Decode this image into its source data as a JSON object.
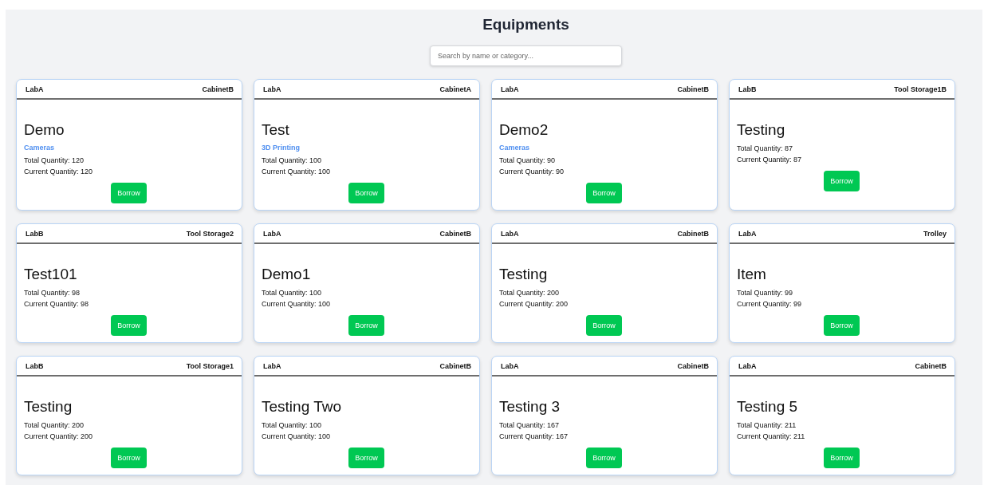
{
  "title": "Equipments",
  "search": {
    "placeholder": "Search by name or category..."
  },
  "cards": [
    {
      "lab": "LabA",
      "storage": "CabinetB",
      "name": "Demo",
      "category": "Cameras",
      "total": "Total Quantity: 120",
      "current": "Current Quantity: 120",
      "button": "Borrow"
    },
    {
      "lab": "LabA",
      "storage": "CabinetA",
      "name": "Test",
      "category": "3D Printing",
      "total": "Total Quantity: 100",
      "current": "Current Quantity: 100",
      "button": "Borrow"
    },
    {
      "lab": "LabA",
      "storage": "CabinetB",
      "name": "Demo2",
      "category": "Cameras",
      "total": "Total Quantity: 90",
      "current": "Current Quantity: 90",
      "button": "Borrow"
    },
    {
      "lab": "LabB",
      "storage": "Tool Storage1B",
      "name": "Testing",
      "total": "Total Quantity: 87",
      "current": "Current Quantity: 87",
      "button": "Borrow"
    },
    {
      "lab": "LabB",
      "storage": "Tool Storage2",
      "name": "Test101",
      "total": "Total Quantity: 98",
      "current": "Current Quantity: 98",
      "button": "Borrow"
    },
    {
      "lab": "LabA",
      "storage": "CabinetB",
      "name": "Demo1",
      "total": "Total Quantity: 100",
      "current": "Current Quantity: 100",
      "button": "Borrow"
    },
    {
      "lab": "LabA",
      "storage": "CabinetB",
      "name": "Testing",
      "total": "Total Quantity: 200",
      "current": "Current Quantity: 200",
      "button": "Borrow"
    },
    {
      "lab": "LabA",
      "storage": "Trolley",
      "name": "Item",
      "total": "Total Quantity: 99",
      "current": "Current Quantity: 99",
      "button": "Borrow"
    },
    {
      "lab": "LabB",
      "storage": "Tool Storage1",
      "name": "Testing",
      "total": "Total Quantity: 200",
      "current": "Current Quantity: 200",
      "button": "Borrow"
    },
    {
      "lab": "LabA",
      "storage": "CabinetB",
      "name": "Testing Two",
      "total": "Total Quantity: 100",
      "current": "Current Quantity: 100",
      "button": "Borrow"
    },
    {
      "lab": "LabA",
      "storage": "CabinetB",
      "name": "Testing 3",
      "total": "Total Quantity: 167",
      "current": "Current Quantity: 167",
      "button": "Borrow"
    },
    {
      "lab": "LabA",
      "storage": "CabinetB",
      "name": "Testing 5",
      "total": "Total Quantity: 211",
      "current": "Current Quantity: 211",
      "button": "Borrow"
    }
  ]
}
